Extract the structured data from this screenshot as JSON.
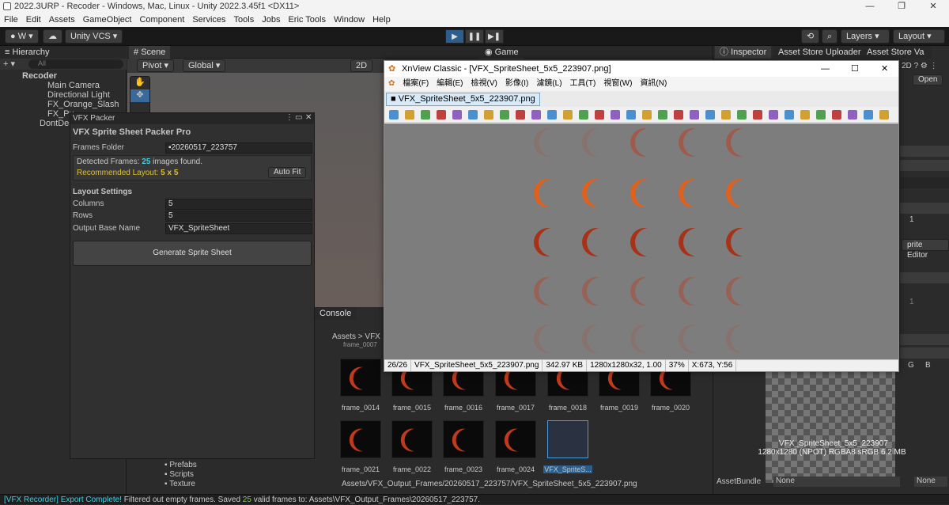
{
  "window": {
    "title": "2022.3URP - Recoder - Windows, Mac, Linux - Unity 2022.3.45f1 <DX11>"
  },
  "menu": [
    "File",
    "Edit",
    "Assets",
    "GameObject",
    "Component",
    "Services",
    "Tools",
    "Jobs",
    "Eric Tools",
    "Window",
    "Help"
  ],
  "toolbar": {
    "account": "W",
    "vcs": "Unity VCS",
    "layers": "Layers",
    "layout": "Layout"
  },
  "hierarchy": {
    "tab": "Hierarchy",
    "search_placeholder": "All",
    "items": [
      "Recoder",
      "Main Camera",
      "Directional Light",
      "FX_Orange_Slash",
      "FX_Pu",
      "DontDes"
    ]
  },
  "scene": {
    "tab": "Scene",
    "game_tab": "Game",
    "pivot": "Pivot",
    "global": "Global",
    "mode2d": "2D"
  },
  "inspector": {
    "tab": "Inspector",
    "asset_store_uploader": "Asset Store Uploader",
    "asset_store_va": "Asset Store Va",
    "open": "Open",
    "sprite_editor": "prite Editor",
    "value1": "1",
    "value2": "1",
    "asset_bundle_label": "AssetBundle",
    "asset_bundle_value": "None",
    "asset_bundle_variant": "None",
    "preview_name": "VFX_SpriteSheet_5x5_223907",
    "preview_info": "1280x1280 (NPOT)  RGBA8 sRGB   6.2 MB",
    "g": "G",
    "b": "B",
    "twod": "2D"
  },
  "vfx_packer": {
    "tab": "VFX Packer",
    "title": "VFX Sprite Sheet Packer Pro",
    "frames_folder_label": "Frames Folder",
    "frames_folder_value": "20260517_223757",
    "detected_prefix": "Detected Frames: ",
    "detected_count": "25",
    "detected_suffix": " images found.",
    "recommended_prefix": "Recommended Layout: ",
    "recommended_value": "5 x 5",
    "auto_fit": "Auto Fit",
    "layout_settings": "Layout Settings",
    "columns_label": "Columns",
    "columns_value": "5",
    "rows_label": "Rows",
    "rows_value": "5",
    "output_label": "Output Base Name",
    "output_value": "VFX_SpriteSheet",
    "generate": "Generate Sprite Sheet"
  },
  "project": {
    "console_tab": "Console",
    "breadcrumb": "Assets  >  VFX",
    "path": "Assets/VFX_Output_Frames/20260517_223757/VFX_SpriteSheet_5x5_223907.png",
    "top_cut": "frame_0007",
    "folders": [
      "Prefabs",
      "Scripts",
      "Texture"
    ],
    "thumbs": [
      "frame_0014",
      "frame_0015",
      "frame_0016",
      "frame_0017",
      "frame_0018",
      "frame_0019",
      "frame_0020",
      "frame_0021",
      "frame_0022",
      "frame_0023",
      "frame_0024",
      "VFX_SpriteS..."
    ]
  },
  "xnview": {
    "title": "XnView Classic - [VFX_SpriteSheet_5x5_223907.png]",
    "menu": [
      "檔案(F)",
      "編輯(E)",
      "檢視(V)",
      "影像(I)",
      "濾鏡(L)",
      "工具(T)",
      "視窗(W)",
      "資訊(N)"
    ],
    "tab": "VFX_SpriteSheet_5x5_223907.png",
    "status": [
      "26/26",
      "VFX_SpriteSheet_5x5_223907.png",
      "342.97 KB",
      "1280x1280x32, 1.00",
      "37%",
      "X:673, Y:56"
    ]
  },
  "status": {
    "prefix": "[VFX Recorder] Export Complete!",
    "mid": " Filtered out empty frames. Saved ",
    "count": "25",
    "suffix": " valid frames to: Assets\\VFX_Output_Frames\\20260517_223757."
  },
  "colors": {
    "accent": "#4a9bd9",
    "cyan_count": "#3fd0e0",
    "yellow": "#e0c030",
    "flame": "#c03a1c"
  }
}
